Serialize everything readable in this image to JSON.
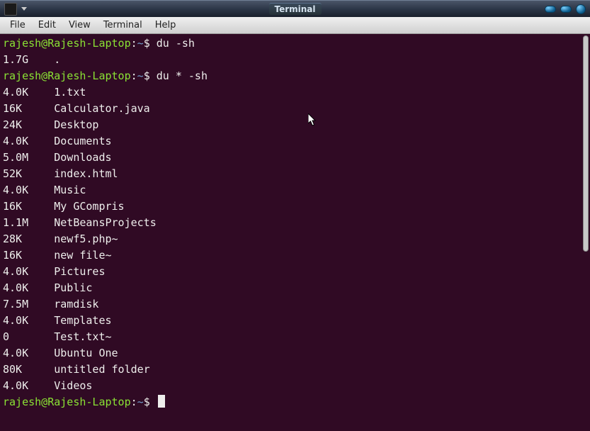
{
  "window": {
    "title": "Terminal"
  },
  "menubar": {
    "items": [
      "File",
      "Edit",
      "View",
      "Terminal",
      "Help"
    ]
  },
  "prompt": {
    "user_host": "rajesh@Rajesh-Laptop",
    "sep1": ":",
    "path": "~",
    "sep2": "$"
  },
  "commands": {
    "cmd1": "du -sh",
    "cmd2": "du * -sh"
  },
  "output1": {
    "size": "1.7G",
    "name": "."
  },
  "listing": [
    {
      "size": "4.0K",
      "name": "1.txt"
    },
    {
      "size": "16K",
      "name": "Calculator.java"
    },
    {
      "size": "24K",
      "name": "Desktop"
    },
    {
      "size": "4.0K",
      "name": "Documents"
    },
    {
      "size": "5.0M",
      "name": "Downloads"
    },
    {
      "size": "52K",
      "name": "index.html"
    },
    {
      "size": "4.0K",
      "name": "Music"
    },
    {
      "size": "16K",
      "name": "My GCompris"
    },
    {
      "size": "1.1M",
      "name": "NetBeansProjects"
    },
    {
      "size": "28K",
      "name": "newf5.php~"
    },
    {
      "size": "16K",
      "name": "new file~"
    },
    {
      "size": "4.0K",
      "name": "Pictures"
    },
    {
      "size": "4.0K",
      "name": "Public"
    },
    {
      "size": "7.5M",
      "name": "ramdisk"
    },
    {
      "size": "4.0K",
      "name": "Templates"
    },
    {
      "size": "0",
      "name": "Test.txt~"
    },
    {
      "size": "4.0K",
      "name": "Ubuntu One"
    },
    {
      "size": "80K",
      "name": "untitled folder"
    },
    {
      "size": "4.0K",
      "name": "Videos"
    }
  ]
}
